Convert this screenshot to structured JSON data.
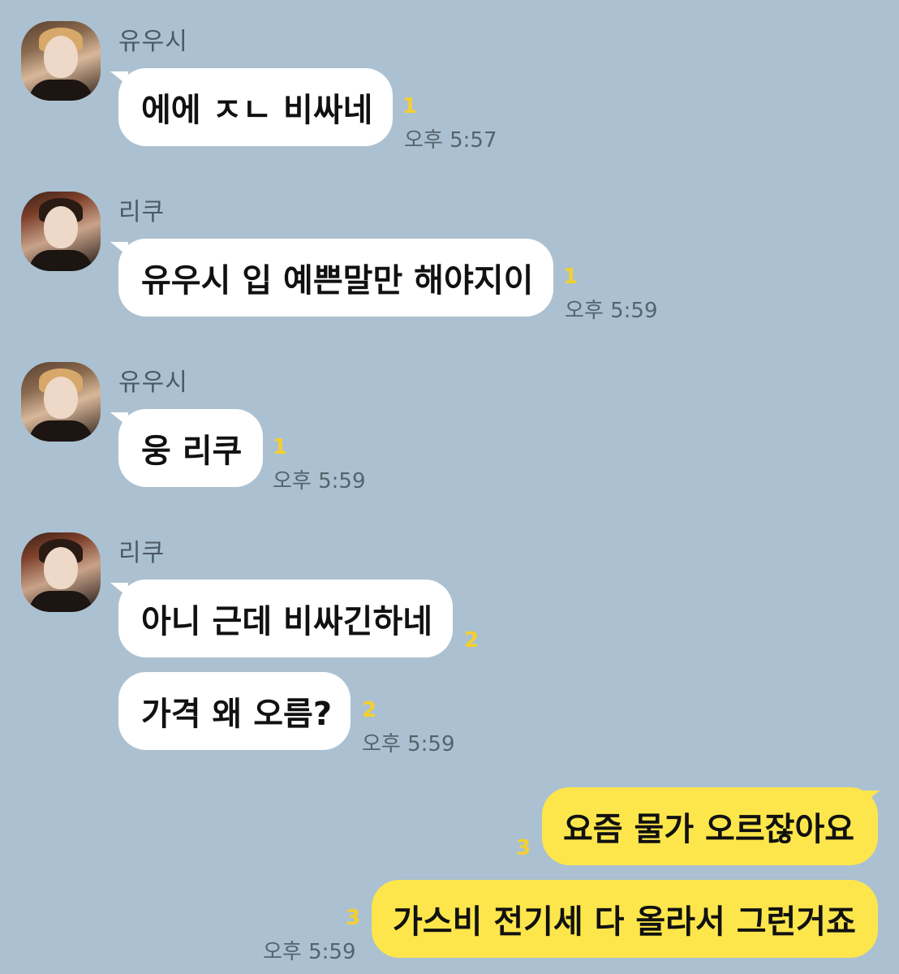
{
  "chat": {
    "messages": [
      {
        "sender": "유우시",
        "text": "에에 ㅈㄴ 비싸네",
        "unread": "1",
        "time": "오후 5:57"
      },
      {
        "sender": "리쿠",
        "text": "유우시 입 예쁜말만 해야지이",
        "unread": "1",
        "time": "오후 5:59"
      },
      {
        "sender": "유우시",
        "text": "웅 리쿠",
        "unread": "1",
        "time": "오후 5:59"
      },
      {
        "sender": "리쿠",
        "text": "아니 근데 비싸긴하네",
        "unread": "2",
        "time": ""
      },
      {
        "sender": "리쿠",
        "text": "가격 왜 오름?",
        "unread": "2",
        "time": "오후 5:59"
      },
      {
        "sender": "me",
        "text": "요즘 물가 오르잖아요",
        "unread": "3",
        "time": ""
      },
      {
        "sender": "me",
        "text": "가스비 전기세 다 올라서 그런거죠",
        "unread": "3",
        "time": "오후 5:59"
      }
    ]
  },
  "colors": {
    "background": "#abc1d1",
    "incoming_bubble": "#ffffff",
    "outgoing_bubble": "#fde64b",
    "unread_count": "#f4d02e"
  }
}
